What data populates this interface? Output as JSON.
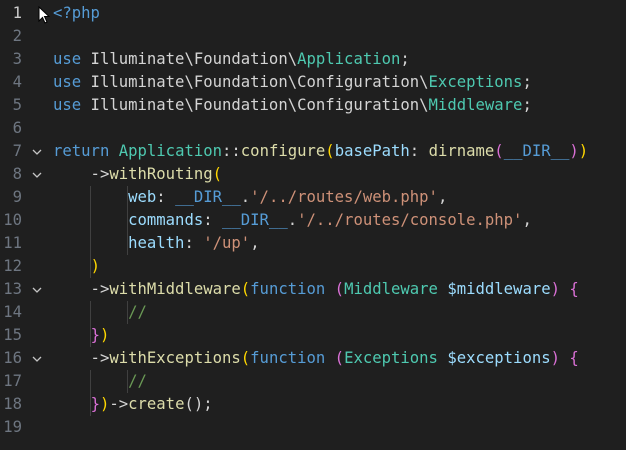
{
  "editor": {
    "language": "php",
    "active_line": 1,
    "lines": [
      {
        "number": "1",
        "fold": false,
        "tokens": [
          {
            "t": "<?php",
            "c": "tag"
          }
        ]
      },
      {
        "number": "2",
        "fold": false,
        "tokens": []
      },
      {
        "number": "3",
        "fold": false,
        "tokens": [
          {
            "t": "use",
            "c": "kw"
          },
          {
            "t": " Illuminate\\Foundation\\",
            "c": "plain"
          },
          {
            "t": "Application",
            "c": "cls"
          },
          {
            "t": ";",
            "c": "plain"
          }
        ]
      },
      {
        "number": "4",
        "fold": false,
        "tokens": [
          {
            "t": "use",
            "c": "kw"
          },
          {
            "t": " Illuminate\\Foundation\\Configuration\\",
            "c": "plain"
          },
          {
            "t": "Exceptions",
            "c": "cls"
          },
          {
            "t": ";",
            "c": "plain"
          }
        ]
      },
      {
        "number": "5",
        "fold": false,
        "tokens": [
          {
            "t": "use",
            "c": "kw"
          },
          {
            "t": " Illuminate\\Foundation\\Configuration\\",
            "c": "plain"
          },
          {
            "t": "Middleware",
            "c": "cls"
          },
          {
            "t": ";",
            "c": "plain"
          }
        ]
      },
      {
        "number": "6",
        "fold": false,
        "tokens": []
      },
      {
        "number": "7",
        "fold": true,
        "tokens": [
          {
            "t": "return",
            "c": "kw"
          },
          {
            "t": " ",
            "c": "plain"
          },
          {
            "t": "Application",
            "c": "cls"
          },
          {
            "t": "::",
            "c": "plain"
          },
          {
            "t": "configure",
            "c": "fn"
          },
          {
            "t": "(",
            "c": "b1"
          },
          {
            "t": "basePath",
            "c": "prop"
          },
          {
            "t": ": ",
            "c": "plain"
          },
          {
            "t": "dirname",
            "c": "fn"
          },
          {
            "t": "(",
            "c": "b2"
          },
          {
            "t": "__DIR__",
            "c": "const"
          },
          {
            "t": ")",
            "c": "b2"
          },
          {
            "t": ")",
            "c": "b1"
          }
        ]
      },
      {
        "number": "8",
        "fold": true,
        "tokens": [
          {
            "t": "    ->",
            "c": "plain"
          },
          {
            "t": "withRouting",
            "c": "fn"
          },
          {
            "t": "(",
            "c": "b1"
          }
        ]
      },
      {
        "number": "9",
        "fold": false,
        "tokens": [
          {
            "t": "        ",
            "c": "plain"
          },
          {
            "t": "web",
            "c": "prop"
          },
          {
            "t": ": ",
            "c": "plain"
          },
          {
            "t": "__DIR__",
            "c": "const"
          },
          {
            "t": ".",
            "c": "plain"
          },
          {
            "t": "'/../routes/web.php'",
            "c": "str"
          },
          {
            "t": ",",
            "c": "plain"
          }
        ]
      },
      {
        "number": "10",
        "fold": false,
        "tokens": [
          {
            "t": "        ",
            "c": "plain"
          },
          {
            "t": "commands",
            "c": "prop"
          },
          {
            "t": ": ",
            "c": "plain"
          },
          {
            "t": "__DIR__",
            "c": "const"
          },
          {
            "t": ".",
            "c": "plain"
          },
          {
            "t": "'/../routes/console.php'",
            "c": "str"
          },
          {
            "t": ",",
            "c": "plain"
          }
        ]
      },
      {
        "number": "11",
        "fold": false,
        "tokens": [
          {
            "t": "        ",
            "c": "plain"
          },
          {
            "t": "health",
            "c": "prop"
          },
          {
            "t": ": ",
            "c": "plain"
          },
          {
            "t": "'/up'",
            "c": "str"
          },
          {
            "t": ",",
            "c": "plain"
          }
        ]
      },
      {
        "number": "12",
        "fold": false,
        "tokens": [
          {
            "t": "    ",
            "c": "plain"
          },
          {
            "t": ")",
            "c": "b1"
          }
        ]
      },
      {
        "number": "13",
        "fold": true,
        "tokens": [
          {
            "t": "    ->",
            "c": "plain"
          },
          {
            "t": "withMiddleware",
            "c": "fn"
          },
          {
            "t": "(",
            "c": "b1"
          },
          {
            "t": "function",
            "c": "kw2"
          },
          {
            "t": " ",
            "c": "plain"
          },
          {
            "t": "(",
            "c": "b2"
          },
          {
            "t": "Middleware",
            "c": "cls"
          },
          {
            "t": " ",
            "c": "plain"
          },
          {
            "t": "$middleware",
            "c": "prop"
          },
          {
            "t": ")",
            "c": "b2"
          },
          {
            "t": " ",
            "c": "plain"
          },
          {
            "t": "{",
            "c": "b2"
          }
        ]
      },
      {
        "number": "14",
        "fold": false,
        "tokens": [
          {
            "t": "        ",
            "c": "plain"
          },
          {
            "t": "//",
            "c": "com"
          }
        ]
      },
      {
        "number": "15",
        "fold": false,
        "tokens": [
          {
            "t": "    ",
            "c": "plain"
          },
          {
            "t": "}",
            "c": "b2"
          },
          {
            "t": ")",
            "c": "b1"
          }
        ]
      },
      {
        "number": "16",
        "fold": true,
        "tokens": [
          {
            "t": "    ->",
            "c": "plain"
          },
          {
            "t": "withExceptions",
            "c": "fn"
          },
          {
            "t": "(",
            "c": "b1"
          },
          {
            "t": "function",
            "c": "kw2"
          },
          {
            "t": " ",
            "c": "plain"
          },
          {
            "t": "(",
            "c": "b2"
          },
          {
            "t": "Exceptions",
            "c": "cls"
          },
          {
            "t": " ",
            "c": "plain"
          },
          {
            "t": "$exceptions",
            "c": "prop"
          },
          {
            "t": ")",
            "c": "b2"
          },
          {
            "t": " ",
            "c": "plain"
          },
          {
            "t": "{",
            "c": "b2"
          }
        ]
      },
      {
        "number": "17",
        "fold": false,
        "tokens": [
          {
            "t": "        ",
            "c": "plain"
          },
          {
            "t": "//",
            "c": "com"
          }
        ]
      },
      {
        "number": "18",
        "fold": false,
        "tokens": [
          {
            "t": "    ",
            "c": "plain"
          },
          {
            "t": "}",
            "c": "b2"
          },
          {
            "t": ")",
            "c": "b1"
          },
          {
            "t": "->",
            "c": "plain"
          },
          {
            "t": "create",
            "c": "fn"
          },
          {
            "t": "();",
            "c": "plain"
          }
        ]
      },
      {
        "number": "19",
        "fold": false,
        "tokens": []
      }
    ]
  },
  "colors": {
    "background": "#1f1f1f",
    "line_number": "#6e7681",
    "line_number_active": "#cccccc",
    "keyword": "#569cd6",
    "class": "#4ec9b0",
    "function": "#dcdcaa",
    "property": "#9cdcfe",
    "string": "#ce9178",
    "comment": "#6a9955",
    "bracket_level1": "#ffd700",
    "bracket_level2": "#da70d6"
  },
  "icons": {
    "fold": "chevron-down-icon",
    "cursor": "mouse-pointer-icon"
  }
}
